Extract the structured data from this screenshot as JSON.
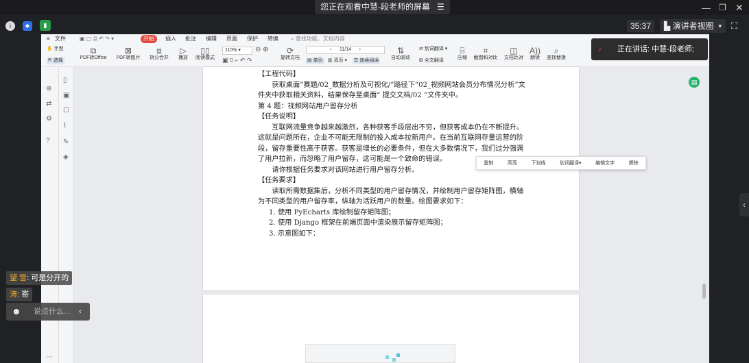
{
  "share": {
    "banner": "您正在观看中慧-段老师的屏幕"
  },
  "meeting": {
    "timer": "35:37",
    "view_button": "演讲者视图"
  },
  "app": {
    "menu": [
      "文件",
      "开始",
      "插入",
      "批注",
      "编辑",
      "页面",
      "保护",
      "转换"
    ],
    "search_placeholder": "查找功能、文档内容",
    "tools": {
      "hand": "手型",
      "select": "选择",
      "pdf_to_office": "PDF转Office",
      "pdf_to_image": "PDF转图片",
      "split_merge": "拆分合并",
      "play": "播放",
      "read_mode": "阅读模式",
      "zoom": "110%",
      "page_indicator": "11/14",
      "rotate": "旋转文档",
      "single_page": "单页",
      "double_page": "双页",
      "continuous": "连续阅读",
      "auto_scroll": "自动滚动",
      "translate": "划词翻译",
      "full_translate": "全文翻译",
      "compress": "压缩",
      "screenshot_compare": "截图和对比",
      "doc_compare": "文档比对",
      "read_aloud": "朗读",
      "find_replace": "查找替换"
    }
  },
  "document": {
    "heading_code": "【工程代码】",
    "code_para": "获取桌面“赛题/02_数据分析及可视化/”路径下“02_视频网站会员分布情况分析”文件夹中获取相关资料，结果保存至桌面“ 提交文档/02 ”文件夹中。",
    "question_title": "第 4 题：视频网站用户留存分析",
    "heading_task_desc": "【任务说明】",
    "task_desc": "互联网流量竞争越来越激烈，各种获客手段层出不穷，但获客成本仍在不断提升。这就是问题所在，企业不可能无限制的投入成本拉新用户。在当前互联网存量运营的阶段，留存重要性高于获客。获客是增长的必要条件，但在大多数情况下，我们过分强调了用户拉新，而忽略了用户留存，这可能是一个致命的错误。",
    "task_ask": "请你根据任务要求对该网站进行用户留存分析。",
    "heading_req": "【任务要求】",
    "req_para": "读取所需数据集后，分析不同类型的用户留存情况，并绘制用户留存矩阵图，横轴为不同类型的用户留存率，纵轴为活跃用户的数量。绘图要求如下：",
    "req_items": [
      "1. 使用 PyEcharts 库绘制留存矩阵图；",
      "2. 使用 Django 框架在前端页面中渲染展示留存矩阵图；",
      "3. 示意图如下："
    ]
  },
  "context_menu": [
    "复制",
    "高亮",
    "下划线",
    "划词翻译",
    "编辑文字",
    "擦除"
  ],
  "speaking": {
    "text": "正在讲话: 中慧-段老师;"
  },
  "chat": [
    {
      "name": "望.雪",
      "message": "可是分开的"
    },
    {
      "name": "涛",
      "message": "寄"
    }
  ],
  "chat_input": {
    "placeholder": "说点什么..."
  },
  "colors": {
    "accent": "#e04a3c",
    "badge": "#24b36b",
    "speaking_bg": "#2d2d2d"
  }
}
